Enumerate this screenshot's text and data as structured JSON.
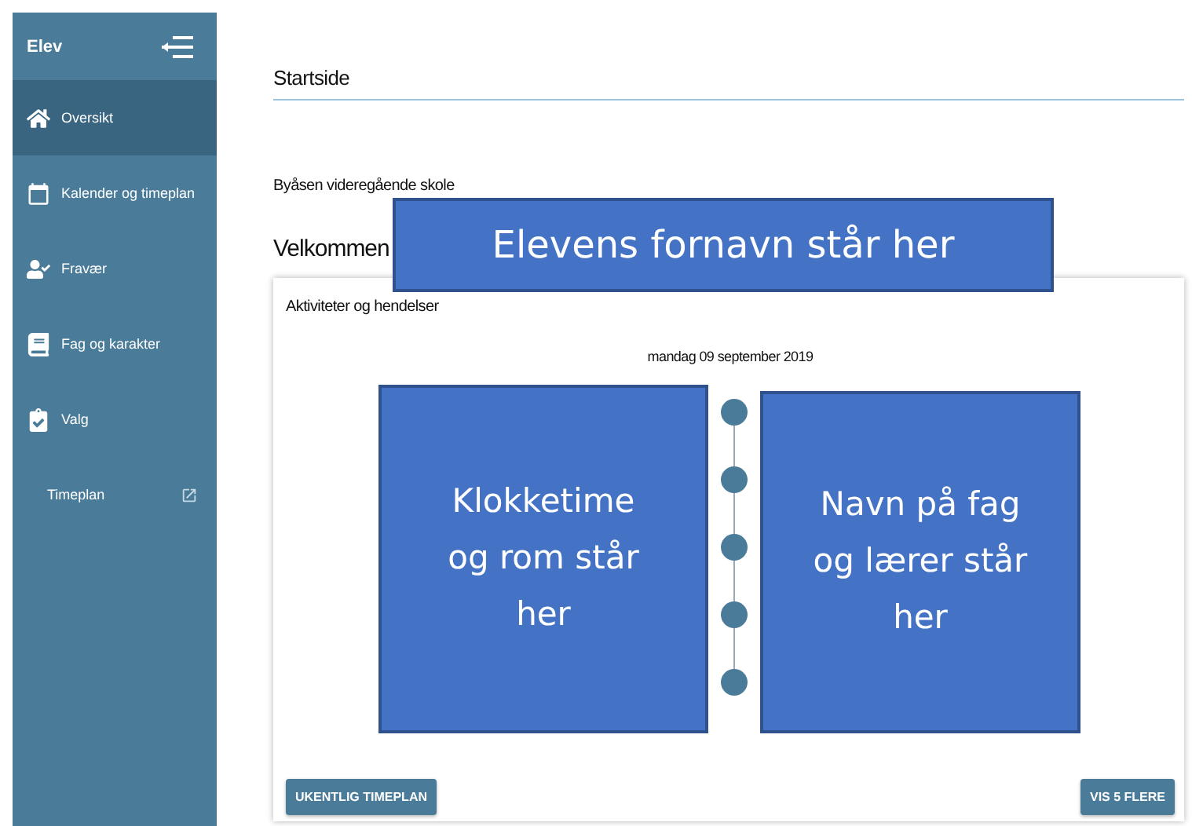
{
  "sidebar": {
    "title": "Elev",
    "items": [
      {
        "label": "Oversikt",
        "selected": true,
        "kind": "nav"
      },
      {
        "label": "Kalender og timeplan",
        "selected": false,
        "kind": "nav"
      },
      {
        "label": "Fravær",
        "selected": false,
        "kind": "nav"
      },
      {
        "label": "Fag og karakter",
        "selected": false,
        "kind": "nav"
      },
      {
        "label": "Valg",
        "selected": false,
        "kind": "nav"
      },
      {
        "label": "Timeplan",
        "selected": false,
        "kind": "external"
      }
    ]
  },
  "page_title": "Startside",
  "school": "Byåsen videregående skole",
  "welcome": "Velkommen",
  "name_overlay": "Elevens fornavn står her",
  "card": {
    "title": "Aktiviteter og hendelser",
    "date": "mandag 09 september 2019",
    "time_overlay": "Klokketime og rom står her",
    "subject_overlay": "Navn på fag og lærer står her",
    "buttons": [
      "UKENTLIG TIMEPLAN",
      "VIS 5 FLERE"
    ]
  }
}
